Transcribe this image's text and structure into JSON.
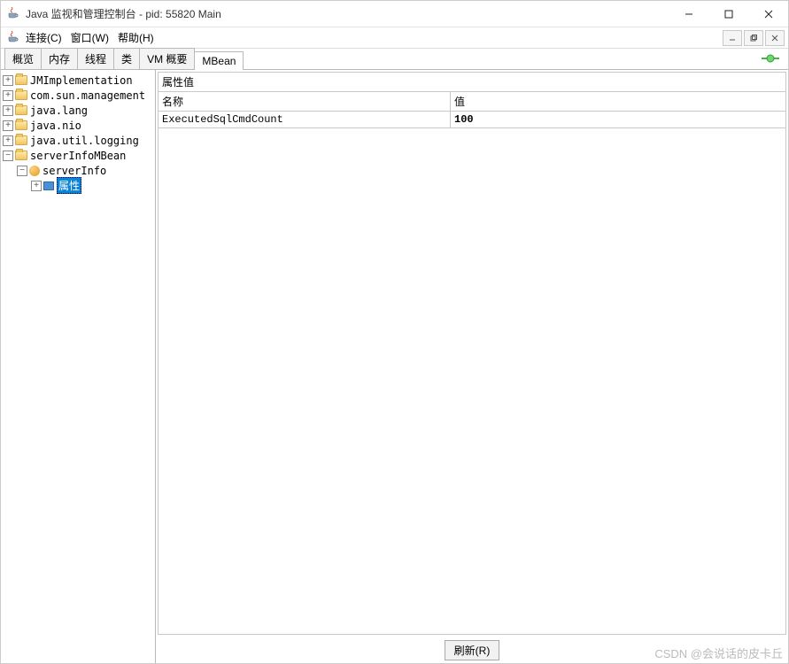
{
  "window": {
    "title": "Java 监视和管理控制台 - pid: 55820 Main"
  },
  "menu": {
    "connect": "连接(C)",
    "window": "窗口(W)",
    "help": "帮助(H)"
  },
  "tabs": {
    "overview": "概览",
    "memory": "内存",
    "threads": "线程",
    "classes": "类",
    "vm_summary": "VM 概要",
    "mbean": "MBean"
  },
  "tree": {
    "items": {
      "0": {
        "label": "JMImplementation"
      },
      "1": {
        "label": "com.sun.management"
      },
      "2": {
        "label": "java.lang"
      },
      "3": {
        "label": "java.nio"
      },
      "4": {
        "label": "java.util.logging"
      },
      "5": {
        "label": "serverInfoMBean"
      },
      "serverInfo": {
        "label": "serverInfo"
      },
      "attrs": {
        "label": "属性"
      }
    }
  },
  "panel": {
    "title": "属性值",
    "col_name": "名称",
    "col_value": "值",
    "row": {
      "name": "ExecutedSqlCmdCount",
      "value": "100"
    }
  },
  "buttons": {
    "refresh": "刷新(R)"
  },
  "watermark": "CSDN @会说话的皮卡丘"
}
